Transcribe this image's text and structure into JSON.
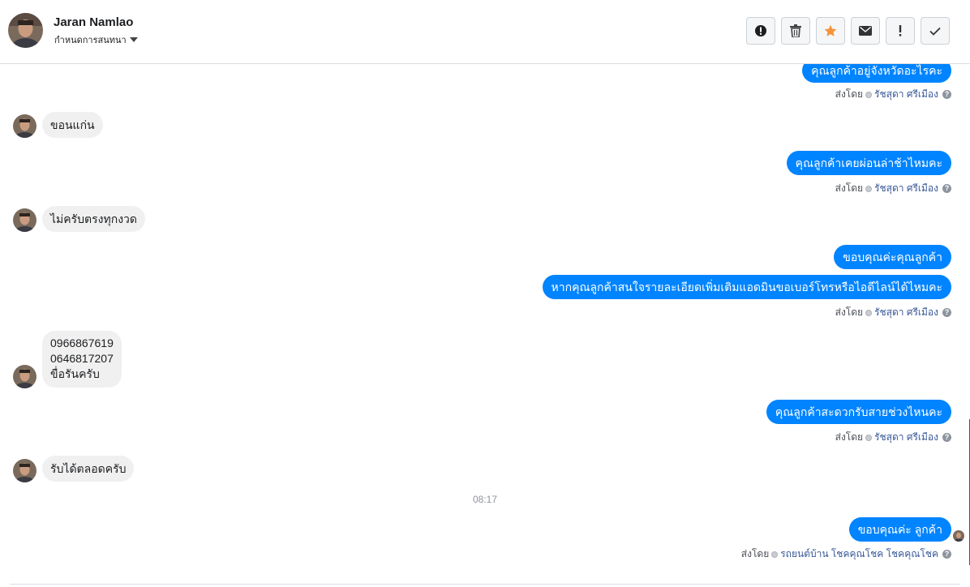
{
  "header": {
    "name": "Jaran Namlao",
    "subtitle": "กำหนดการสนทนา",
    "avatar_icon": "user-photo-icon"
  },
  "toolbar": {
    "buttons": [
      {
        "name": "mark-spam-button",
        "icon": "alert-circle-icon"
      },
      {
        "name": "delete-button",
        "icon": "trash-icon"
      },
      {
        "name": "star-button",
        "icon": "star-icon",
        "color": "#f7923b"
      },
      {
        "name": "mark-unread-button",
        "icon": "envelope-icon"
      },
      {
        "name": "follow-up-button",
        "icon": "exclamation-icon"
      },
      {
        "name": "mark-done-button",
        "icon": "check-icon"
      }
    ]
  },
  "colors": {
    "outgoing_bubble": "#0084ff",
    "incoming_bubble": "#f0f0f0",
    "agent_link": "#385898"
  },
  "messages": [
    {
      "dir": "out",
      "text": "คุณลูกค้าอยู่จังหวัดอะไรคะ"
    },
    {
      "dir": "meta",
      "prefix": "ส่งโดย",
      "agent": "รัชสุดา ศรีเมือง"
    },
    {
      "dir": "in",
      "text": "ขอนแก่น"
    },
    {
      "dir": "out",
      "text": "คุณลูกค้าเคยผ่อนล่าช้าไหมคะ"
    },
    {
      "dir": "meta",
      "prefix": "ส่งโดย",
      "agent": "รัชสุดา ศรีเมือง"
    },
    {
      "dir": "in",
      "text": "ไม่ครับตรงทุกงวด"
    },
    {
      "dir": "out",
      "text": "ขอบคุณค่ะคุณลูกค้า"
    },
    {
      "dir": "out",
      "text": "หากคุณลูกค้าสนใจรายละเอียดเพิ่มเติมแอดมินขอเบอร์โทรหรือไอดีไลน์ได้ไหมคะ"
    },
    {
      "dir": "meta",
      "prefix": "ส่งโดย",
      "agent": "รัชสุดา ศรีเมือง"
    },
    {
      "dir": "in",
      "lines": [
        "0966867619",
        "0646817207",
        "ขื่อรันครับ"
      ]
    },
    {
      "dir": "out",
      "text": "คุณลูกค้าสะดวกรับสายช่วงไหนคะ"
    },
    {
      "dir": "meta",
      "prefix": "ส่งโดย",
      "agent": "รัชสุดา ศรีเมือง"
    },
    {
      "dir": "in",
      "text": "รับได้ตลอดครับ"
    },
    {
      "dir": "time",
      "text": "08:17"
    },
    {
      "dir": "out",
      "text": "ขอบคุณค่ะ ลูกค้า"
    },
    {
      "dir": "meta",
      "prefix": "ส่งโดย",
      "agent": "รถยนต์บ้าน โชคคุณโชค โชคคุณโชค"
    }
  ]
}
